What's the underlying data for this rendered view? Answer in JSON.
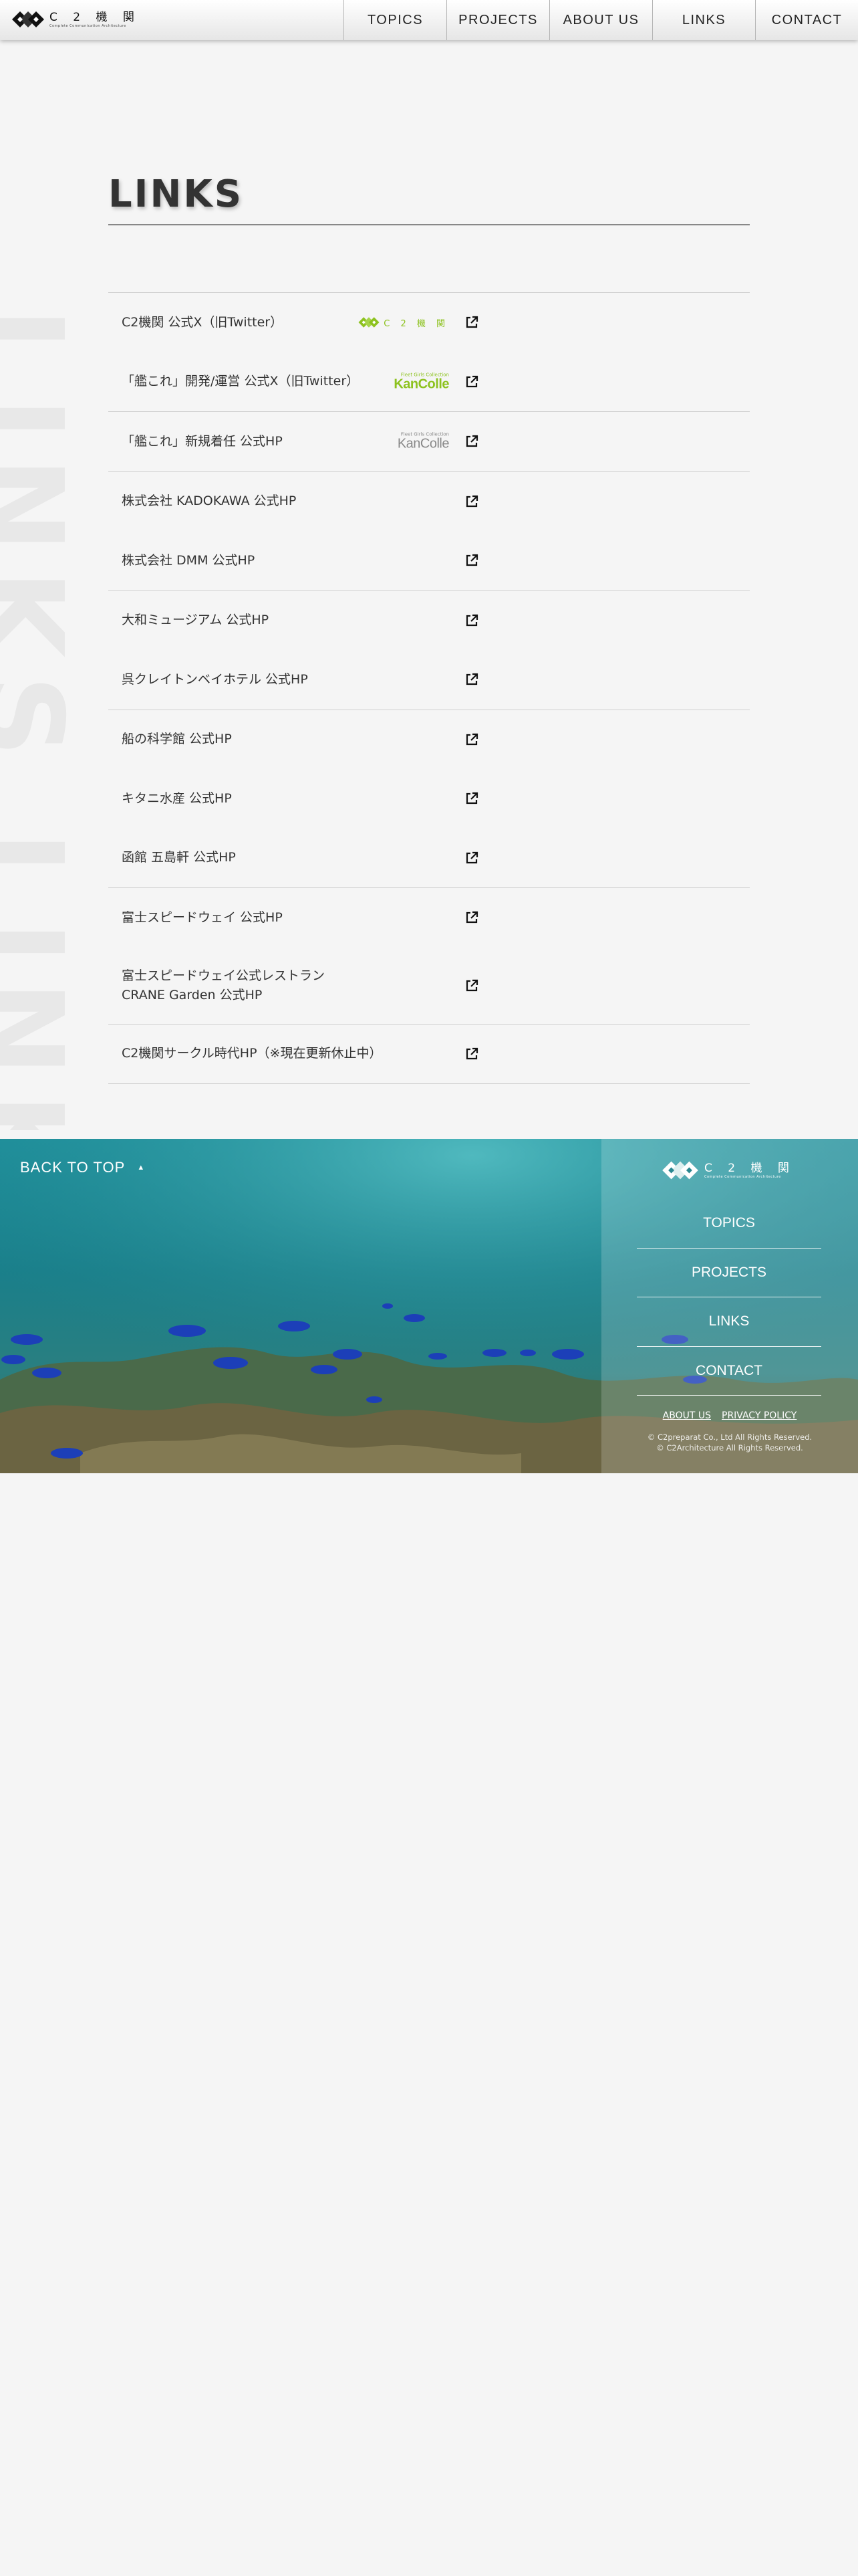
{
  "header": {
    "logo": {
      "kanji": "C 2 機 関",
      "subtitle": "Complete Communication Architecture"
    },
    "nav": [
      "TOPICS",
      "PROJECTS",
      "ABOUT US",
      "LINKS",
      "CONTACT"
    ]
  },
  "watermark": "LINKS LINKS",
  "page_title": "LINKS",
  "link_groups": [
    [
      {
        "label": "C2機関 公式X（旧Twitter）",
        "badge": "c2"
      },
      {
        "label": "「艦これ」開発/運営 公式X（旧Twitter）",
        "badge": "kancolle-green"
      }
    ],
    [
      {
        "label": "「艦これ」新規着任 公式HP",
        "badge": "kancolle-gray"
      }
    ],
    [
      {
        "label": "株式会社 KADOKAWA 公式HP"
      },
      {
        "label": "株式会社 DMM 公式HP"
      }
    ],
    [
      {
        "label": "大和ミュージアム 公式HP"
      },
      {
        "label": "呉クレイトンベイホテル 公式HP"
      }
    ],
    [
      {
        "label": "船の科学館 公式HP"
      },
      {
        "label": "キタニ水産 公式HP"
      },
      {
        "label": "函館 五島軒 公式HP"
      }
    ],
    [
      {
        "label": "富士スピードウェイ 公式HP"
      },
      {
        "label": "富士スピードウェイ公式レストラン\nCRANE Garden 公式HP"
      }
    ],
    [
      {
        "label": "C2機関サークル時代HP（※現在更新休止中）"
      }
    ]
  ],
  "badges": {
    "c2": {
      "kanji": "C 2 機 関",
      "sub": "Complete Communication Architecture"
    },
    "kancolle_green": {
      "small": "Fleet Girls Collection",
      "big": "KanColle"
    },
    "kancolle_gray": {
      "small": "Fleet Girls Collection",
      "big": "KanColle"
    }
  },
  "footer": {
    "back_to_top": "BACK TO TOP",
    "logo": {
      "kanji": "C 2 機 関",
      "subtitle": "Complete Communication Architecture"
    },
    "nav": [
      "TOPICS",
      "PROJECTS",
      "LINKS",
      "CONTACT"
    ],
    "legal_links": [
      "ABOUT US",
      "PRIVACY POLICY"
    ],
    "copyright": [
      "© C2preparat Co., Ltd All Rights Reserved.",
      "© C2Architecture All Rights Reserved."
    ]
  },
  "colors": {
    "accent_green": "#8dc21f",
    "footer_sea": "#1a7f8a",
    "background": "#f5f5f5"
  }
}
